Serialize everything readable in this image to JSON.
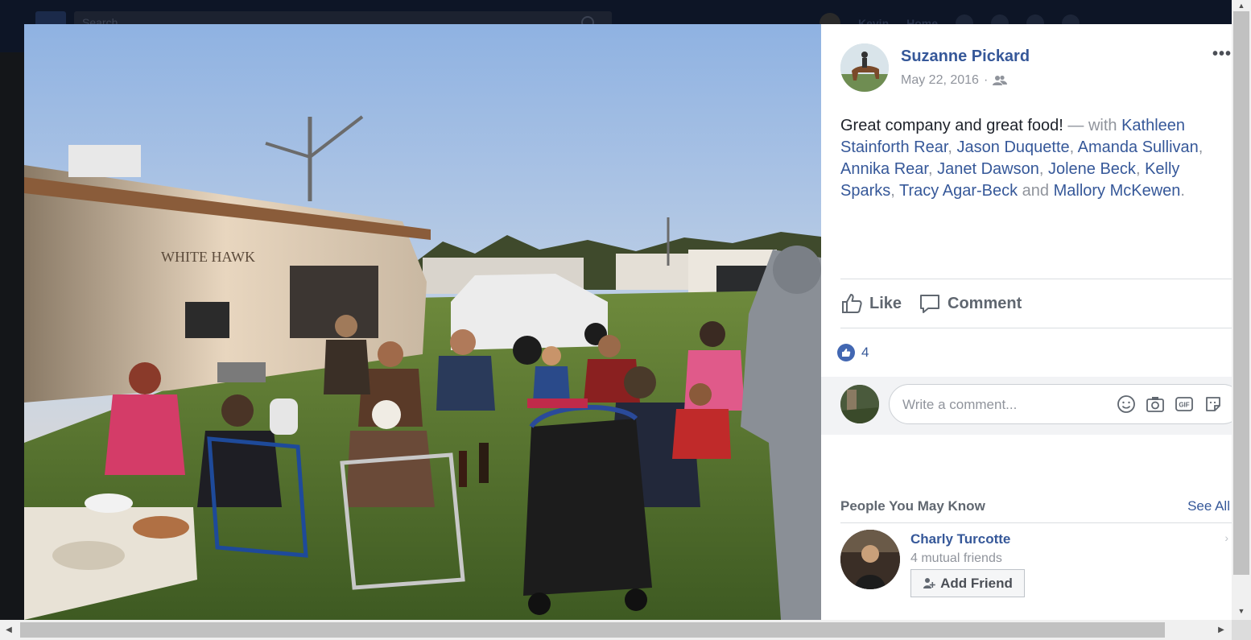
{
  "background_header": {
    "search_placeholder": "Search",
    "user_name": "Kevin",
    "home_label": "Home"
  },
  "post": {
    "author": "Suzanne Pickard",
    "date": "May 22, 2016",
    "separator": "·",
    "more_label": "•••",
    "text": "Great company and great food!",
    "with_prefix": " — with ",
    "tags": [
      "Kathleen Stainforth Rear",
      "Jason Duquette",
      "Amanda Sullivan",
      "Annika Rear",
      "Janet Dawson",
      "Jolene Beck",
      "Kelly Sparks",
      "Tracy Agar-Beck"
    ],
    "and_word": " and ",
    "last_tag": "Mallory McKewen",
    "end_punct": ".",
    "comma": ", ",
    "audience_icon": "friends-icon"
  },
  "actions": {
    "like_label": "Like",
    "comment_label": "Comment"
  },
  "reactions": {
    "count": "4",
    "icon": "thumbs-up-icon",
    "color": "#4267b2"
  },
  "comment_box": {
    "placeholder": "Write a comment...",
    "icons": [
      "emoji-icon",
      "camera-icon",
      "gif-icon",
      "sticker-icon"
    ]
  },
  "pymk": {
    "title": "People You May Know",
    "see_all": "See All",
    "friend_name": "Charly Turcotte",
    "mutual": "4 mutual friends",
    "add_label": "Add Friend"
  },
  "colors": {
    "link": "#365899",
    "muted": "#90949c",
    "text": "#1d2129"
  }
}
